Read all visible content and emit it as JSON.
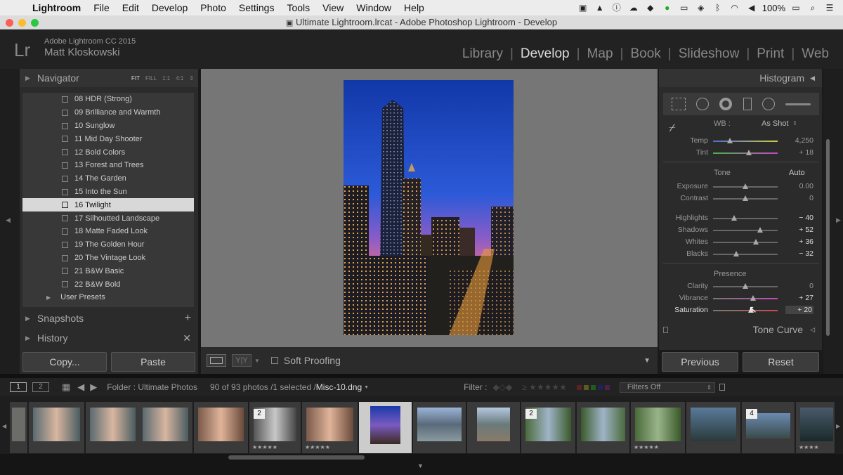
{
  "menubar": {
    "app": "Lightroom",
    "items": [
      "File",
      "Edit",
      "Develop",
      "Photo",
      "Settings",
      "Tools",
      "View",
      "Window",
      "Help"
    ],
    "battery": "100%"
  },
  "window": {
    "title": "Ultimate Lightroom.lrcat - Adobe Photoshop Lightroom - Develop"
  },
  "identity": {
    "logo": "Lr",
    "product": "Adobe Lightroom CC 2015",
    "user": "Matt Kloskowski"
  },
  "modules": [
    "Library",
    "Develop",
    "Map",
    "Book",
    "Slideshow",
    "Print",
    "Web"
  ],
  "active_module": "Develop",
  "left": {
    "navigator": {
      "label": "Navigator",
      "zoom": [
        "FIT",
        "FILL",
        "1:1",
        "4:1"
      ]
    },
    "presets": [
      "08 HDR (Strong)",
      "09 Brilliance and Warmth",
      "10 Sunglow",
      "11 Mid Day Shooter",
      "12 Bold Colors",
      "13 Forest and Trees",
      "14 The Garden",
      "15 Into the Sun",
      "16 Twilight",
      "17 Silhoutted Landscape",
      "18 Matte Faded Look",
      "19 The Golden Hour",
      "20 The Vintage Look",
      "21 B&W Basic",
      "22 B&W Bold"
    ],
    "selected_preset": "16 Twilight",
    "user_presets": "User Presets",
    "snapshots": "Snapshots",
    "history": "History",
    "copy": "Copy...",
    "paste": "Paste"
  },
  "toolbar": {
    "soft_proofing": "Soft Proofing"
  },
  "right": {
    "histogram": "Histogram",
    "wb_label": "WB :",
    "wb_value": "As Shot",
    "temp": {
      "label": "Temp",
      "value": "4,250"
    },
    "tint": {
      "label": "Tint",
      "value": "+ 18"
    },
    "tone": "Tone",
    "auto": "Auto",
    "exposure": {
      "label": "Exposure",
      "value": "0.00"
    },
    "contrast": {
      "label": "Contrast",
      "value": "0"
    },
    "highlights": {
      "label": "Highlights",
      "value": "− 40"
    },
    "shadows": {
      "label": "Shadows",
      "value": "+ 52"
    },
    "whites": {
      "label": "Whites",
      "value": "+ 36"
    },
    "blacks": {
      "label": "Blacks",
      "value": "− 32"
    },
    "presence": "Presence",
    "clarity": {
      "label": "Clarity",
      "value": "0"
    },
    "vibrance": {
      "label": "Vibrance",
      "value": "+ 27"
    },
    "saturation": {
      "label": "Saturation",
      "value": "+ 20"
    },
    "tone_curve": "Tone Curve",
    "previous": "Previous",
    "reset": "Reset"
  },
  "filmbar": {
    "page1": "1",
    "page2": "2",
    "folder": "Folder : Ultimate Photos",
    "count": "90 of 93 photos /1 selected /",
    "filename": "Misc-10.dng",
    "filter": "Filter :",
    "filters_off": "Filters Off"
  },
  "thumbs": [
    {
      "badge": "",
      "stars": ""
    },
    {
      "badge": "",
      "stars": ""
    },
    {
      "badge": "",
      "stars": ""
    },
    {
      "badge": "",
      "stars": ""
    },
    {
      "badge": "2",
      "stars": "★★★★★"
    },
    {
      "badge": "",
      "stars": "★★★★★"
    },
    {
      "badge": "",
      "stars": ""
    },
    {
      "badge": "",
      "stars": ""
    },
    {
      "badge": "",
      "stars": ""
    },
    {
      "badge": "2",
      "stars": ""
    },
    {
      "badge": "",
      "stars": ""
    },
    {
      "badge": "",
      "stars": "★★★★★"
    },
    {
      "badge": "",
      "stars": ""
    },
    {
      "badge": "4",
      "stars": ""
    },
    {
      "badge": "",
      "stars": "★★★★"
    }
  ]
}
